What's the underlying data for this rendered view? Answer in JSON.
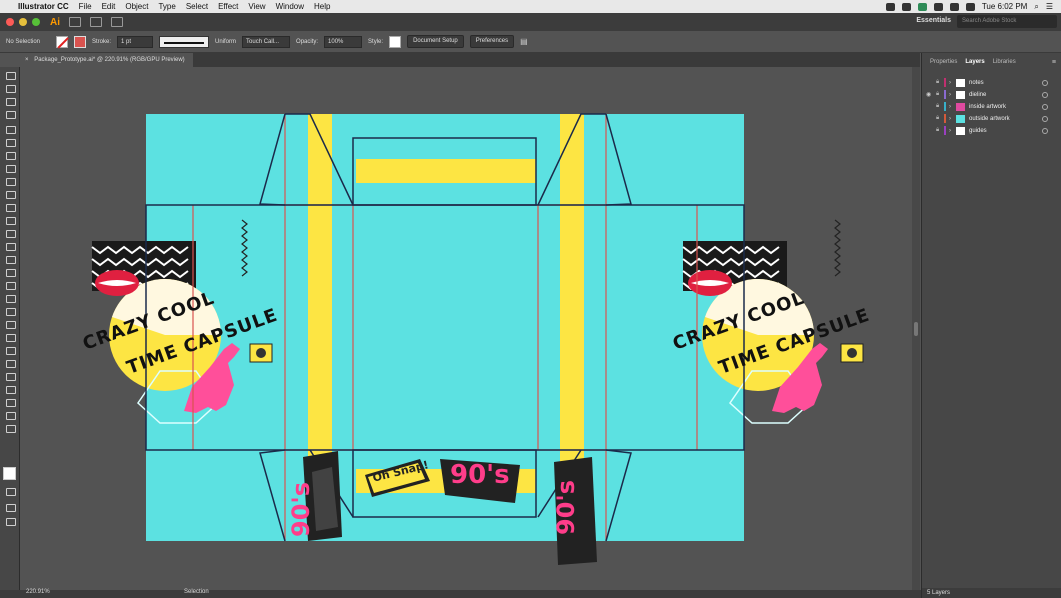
{
  "menubar": {
    "app_name": "Illustrator CC",
    "menus": [
      "File",
      "Edit",
      "Object",
      "Type",
      "Select",
      "Effect",
      "View",
      "Window",
      "Help"
    ],
    "clock": "Tue 6:02 PM"
  },
  "appbar": {
    "logo": "Ai",
    "workspace": "Essentials",
    "stock_search_placeholder": "Search Adobe Stock"
  },
  "control_bar": {
    "selection": "No Selection",
    "stroke_label": "Stroke:",
    "stroke_weight": "1 pt",
    "stroke_profile": "Uniform",
    "brush": "Touch Call...",
    "opacity_label": "Opacity:",
    "opacity": "100%",
    "style_label": "Style:",
    "document_setup": "Document Setup",
    "preferences": "Preferences"
  },
  "document": {
    "tab_title": "Package_Prototype.ai* @ 220.91% (RGB/GPU Preview)"
  },
  "artwork": {
    "left_headline_1": "CRAZY COOL",
    "left_headline_2": "TIME CAPSULE",
    "right_headline_1": "CRAZY COOL",
    "right_headline_2": "TIME CAPSULE",
    "retro_90s_center": "90's",
    "retro_90s_left": "90's",
    "retro_90s_right": "90's",
    "oh_snap": "Oh Snap!",
    "colors": {
      "canvas_cyan": "#5ce1e1",
      "yellow": "#fde543",
      "dieline_red": "#d9534f",
      "fold_navy": "#1b2a4a",
      "pink": "#ff3d8a"
    }
  },
  "panels": {
    "tabs": [
      "Properties",
      "Layers",
      "Libraries"
    ],
    "active_tab": "Layers",
    "layers": [
      {
        "name": "notes",
        "color": "#c03070"
      },
      {
        "name": "dieline",
        "color": "#8a6ad0"
      },
      {
        "name": "inside artwork",
        "color": "#38b0c8"
      },
      {
        "name": "outside artwork",
        "color": "#d45a3a"
      },
      {
        "name": "guides",
        "color": "#9a40c0"
      }
    ],
    "footer": "5 Layers"
  },
  "status_bar": {
    "zoom": "220.91%",
    "tool": "Selection"
  }
}
